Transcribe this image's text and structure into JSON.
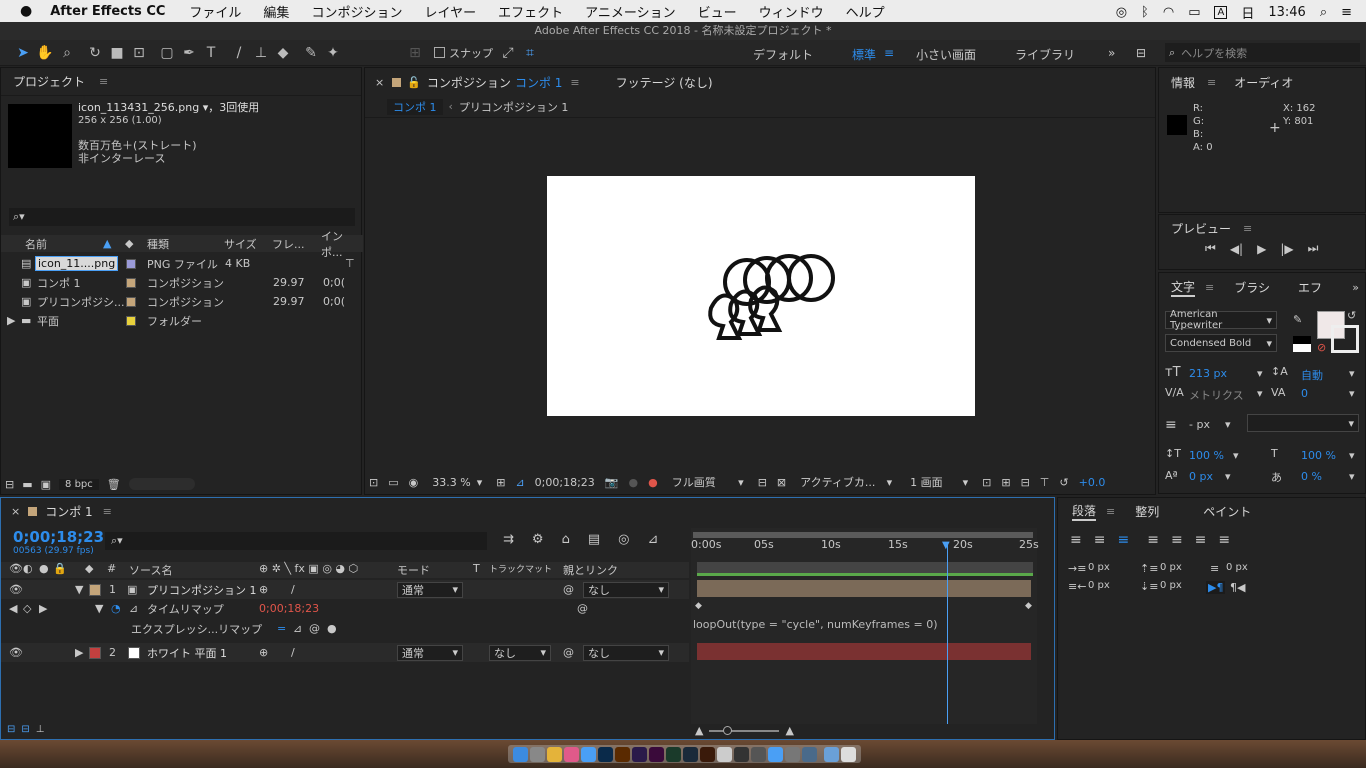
{
  "menubar": {
    "apple": "",
    "app": "After Effects CC",
    "items": [
      "ファイル",
      "編集",
      "コンポジション",
      "レイヤー",
      "エフェクト",
      "アニメーション",
      "ビュー",
      "ウィンドウ",
      "ヘルプ"
    ],
    "day": "日",
    "time": "13:46"
  },
  "window_title": "Adobe After Effects CC 2018 - 名称未設定プロジェクト *",
  "toolbar": {
    "snap_label": "スナップ",
    "workspaces": [
      "デフォルト",
      "標準",
      "小さい画面",
      "ライブラリ"
    ],
    "search_placeholder": "ヘルプを検索"
  },
  "project": {
    "title": "プロジェクト",
    "item_name": "icon_113431_256.png ▾，3回使用",
    "item_size": "256 x 256 (1.00)",
    "item_color": "数百万色＋(ストレート)",
    "item_scan": "非インターレース",
    "columns": [
      "名前",
      "種類",
      "サイズ",
      "フレ...",
      "インポ..."
    ],
    "rows": [
      {
        "name": "icon_11....png",
        "type": "PNG ファイル",
        "size": "4 KB",
        "fps": "",
        "in": "",
        "color": "#9a9ad8"
      },
      {
        "name": "コンポ 1",
        "type": "コンポジション",
        "size": "",
        "fps": "29.97",
        "in": "0;0(",
        "color": "#c4a57a"
      },
      {
        "name": "プリコンポジシ...",
        "type": "コンポジション",
        "size": "",
        "fps": "29.97",
        "in": "0;0(",
        "color": "#c4a57a"
      },
      {
        "name": "平面",
        "type": "フォルダー",
        "size": "",
        "fps": "",
        "in": "",
        "color": "#e8d13c"
      }
    ],
    "bpc": "8 bpc"
  },
  "comp_viewer": {
    "tab_prefix": "コンポジション",
    "tab_name": "コンポ 1",
    "footage_tab": "フッテージ (なし)",
    "breadcrumbs": [
      "コンポ 1",
      "プリコンポジション 1"
    ],
    "zoom": "33.3 %",
    "timecode": "0;00;18;23",
    "quality": "フル画質",
    "camera": "アクティブカ...",
    "views": "1 画面",
    "exposure": "+0.0"
  },
  "info": {
    "title": "情報",
    "tab2": "オーディオ",
    "r": "R:",
    "g": "G:",
    "b": "B:",
    "a": "A:  0",
    "x": "X:  162",
    "y": "Y:  801"
  },
  "preview": {
    "title": "プレビュー"
  },
  "character": {
    "title": "文字",
    "tab2": "ブラシ",
    "tab3": "エフ",
    "font": "American Typewriter",
    "style": "Condensed Bold",
    "size": "213 px",
    "leading": "自動",
    "kerning": "メトリクス",
    "tracking": "0",
    "stroke": "- px",
    "vscale": "100 %",
    "hscale": "100 %",
    "baseline": "0 px",
    "tsume": "0 %"
  },
  "paragraph": {
    "title": "段落",
    "tab2": "整列",
    "tab3": "ペイント",
    "indent_l": "0 px",
    "indent_r": "0 px",
    "space_b": "0 px",
    "space_a": "0 px",
    "first": "0 px"
  },
  "timeline": {
    "tab": "コンポ 1",
    "timecode": "0;00;18;23",
    "frames": "00563 (29.97 fps)",
    "col_source": "ソース名",
    "col_mode": "モード",
    "col_t": "T",
    "col_track": "トラックマット",
    "col_parent": "親とリンク",
    "ruler": [
      "0:00s",
      "05s",
      "10s",
      "15s",
      "20s",
      "25s"
    ],
    "layers": [
      {
        "num": "1",
        "name": "プリコンポジション 1",
        "mode": "通常",
        "track": "",
        "parent": "なし",
        "color": "#c4a57a"
      },
      {
        "num": "2",
        "name": "ホワイト 平面 1",
        "mode": "通常",
        "track": "なし",
        "parent": "なし",
        "color": "#c2403f"
      }
    ],
    "timeremap_label": "タイムリマップ",
    "timeremap_value": "0;00;18;23",
    "expression_label": "エクスプレッシ...リマップ",
    "expression": "loopOut(type = \"cycle\", numKeyframes = 0)"
  },
  "colors": {
    "accent": "#2d8ceb",
    "timecode": "#2d8ceb",
    "red_value": "#e0554a"
  }
}
